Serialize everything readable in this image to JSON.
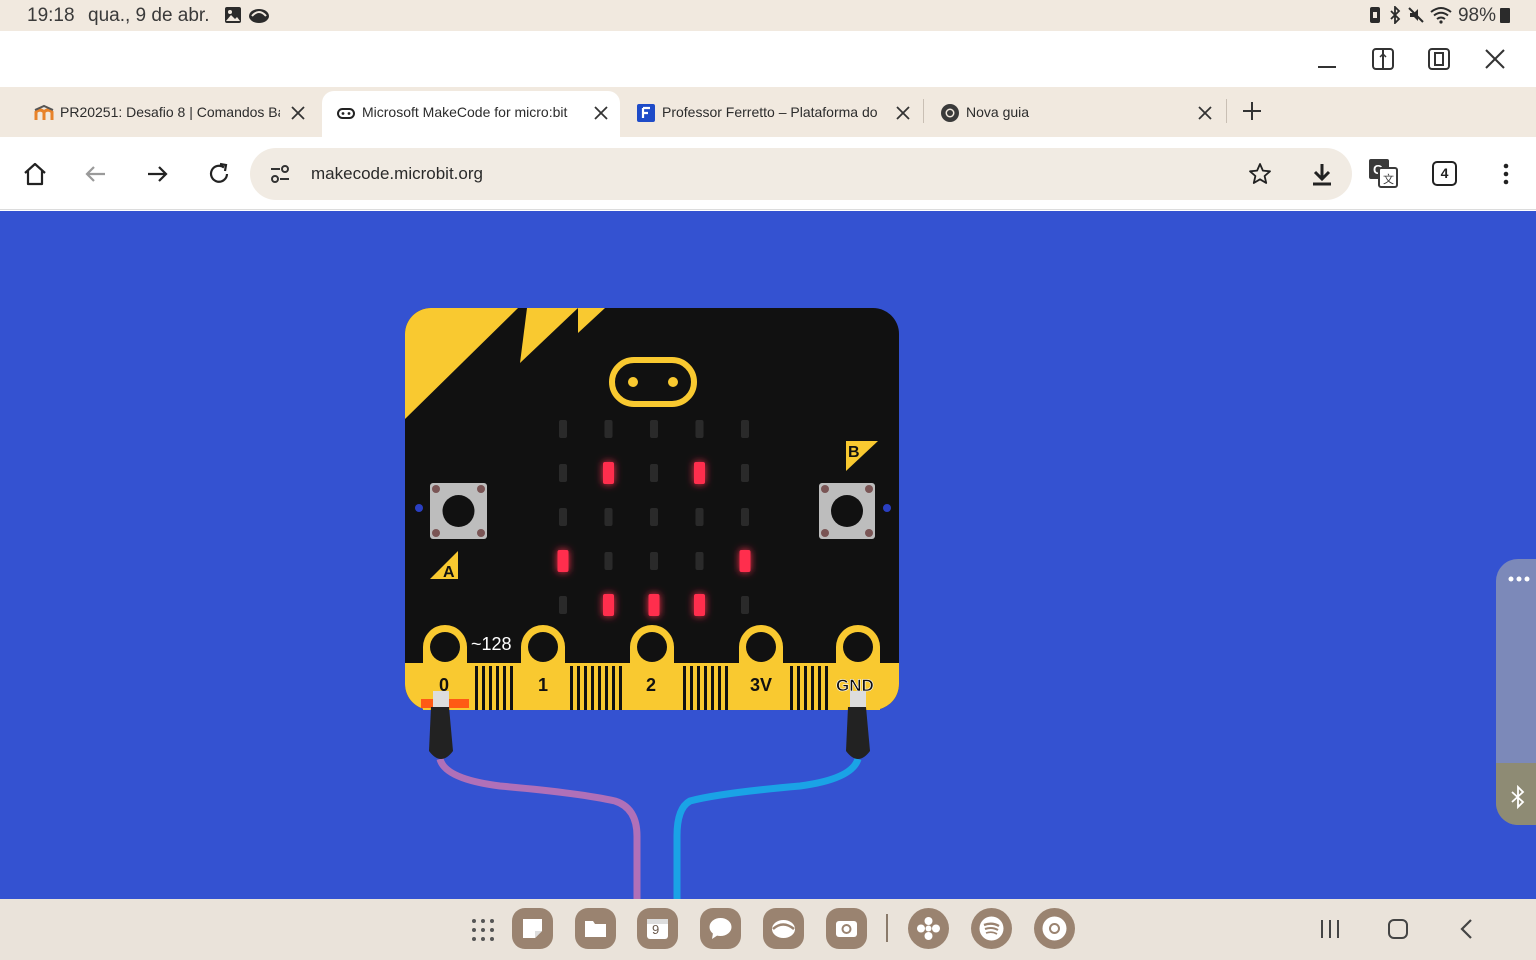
{
  "status_bar": {
    "time": "19:18",
    "date": "qua., 9 de abr.",
    "battery": "98%"
  },
  "tabs": [
    {
      "title": "PR20251: Desafio 8 | Comandos Bá",
      "favicon": "moodle-icon",
      "active": false
    },
    {
      "title": "Microsoft MakeCode for micro:bit",
      "favicon": "makecode-icon",
      "active": true
    },
    {
      "title": "Professor Ferretto – Plataforma do",
      "favicon": "ferretto-icon",
      "active": false
    },
    {
      "title": "Nova guia",
      "favicon": "chrome-icon",
      "active": false
    }
  ],
  "toolbar": {
    "url": "makecode.microbit.org",
    "tab_count": "4"
  },
  "simulator": {
    "button_a_label": "A",
    "button_b_label": "B",
    "pin_value": "~128",
    "pins": [
      "0",
      "1",
      "2",
      "3V",
      "GND"
    ],
    "led_matrix": [
      [
        0,
        0,
        0,
        0,
        0
      ],
      [
        0,
        1,
        0,
        1,
        0
      ],
      [
        0,
        0,
        0,
        0,
        0
      ],
      [
        1,
        0,
        0,
        0,
        1
      ],
      [
        0,
        1,
        1,
        1,
        0
      ]
    ],
    "colors": {
      "background": "#3452d1",
      "board": "#111111",
      "accent": "#f9c930",
      "led_on": "#ff2e4d",
      "led_off": "#2a2a2a",
      "wire_left": "#b070b8",
      "wire_right": "#1aa3e6"
    }
  },
  "dock": {
    "apps": [
      "apps-grid-icon",
      "notes-icon",
      "files-icon",
      "calendar-icon",
      "messages-icon",
      "gallery-icon",
      "camera-icon",
      "bixby-icon",
      "spotify-icon",
      "chrome-icon"
    ],
    "calendar_day": "9"
  }
}
